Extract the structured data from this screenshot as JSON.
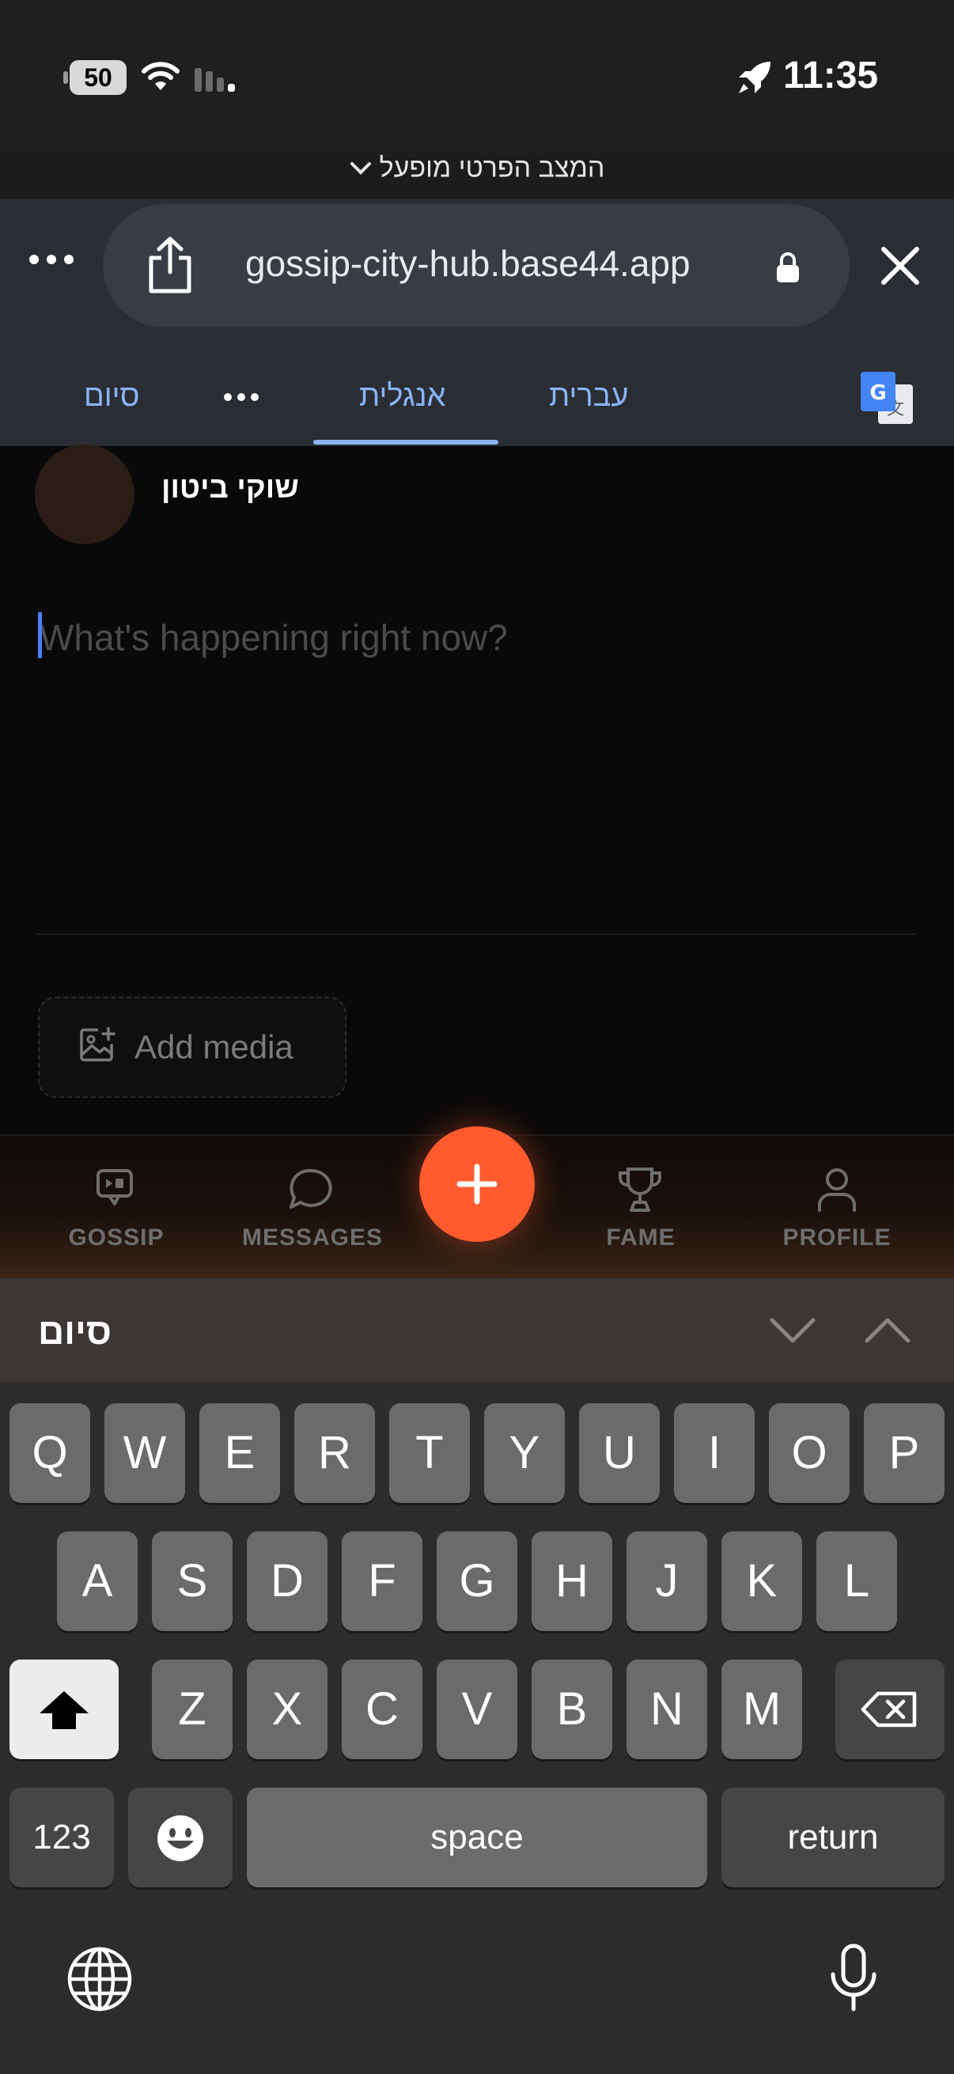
{
  "status_bar": {
    "battery": "50",
    "time": "11:35"
  },
  "browser": {
    "private_mode": "המצב הפרטי מופעל",
    "url": "gossip-city-hub.base44.app"
  },
  "translate_bar": {
    "done": "סיום",
    "more": "•••",
    "lang_english": "אנגלית",
    "lang_hebrew": "עברית"
  },
  "composer": {
    "author_name": "שוקי ביטון",
    "placeholder": "What's happening right now?",
    "add_media": "Add media"
  },
  "bottom_nav": {
    "items": [
      {
        "label": "GOSSIP",
        "icon": "gossip-icon"
      },
      {
        "label": "MESSAGES",
        "icon": "chat-bubble-icon"
      },
      {
        "label": "FAME",
        "icon": "trophy-icon"
      },
      {
        "label": "PROFILE",
        "icon": "person-icon"
      }
    ],
    "fab_icon": "plus-icon"
  },
  "keyboard_accessory": {
    "done": "סיום"
  },
  "keyboard": {
    "row1": [
      "Q",
      "W",
      "E",
      "R",
      "T",
      "Y",
      "U",
      "I",
      "O",
      "P"
    ],
    "row2": [
      "A",
      "S",
      "D",
      "F",
      "G",
      "H",
      "J",
      "K",
      "L"
    ],
    "row3": [
      "Z",
      "X",
      "C",
      "V",
      "B",
      "N",
      "M"
    ],
    "numbers_key": "123",
    "space_key": "space",
    "return_key": "return"
  },
  "colors": {
    "accent": "#ff5b2e",
    "link": "#8ab4f8",
    "cursor": "#4f7dff"
  }
}
